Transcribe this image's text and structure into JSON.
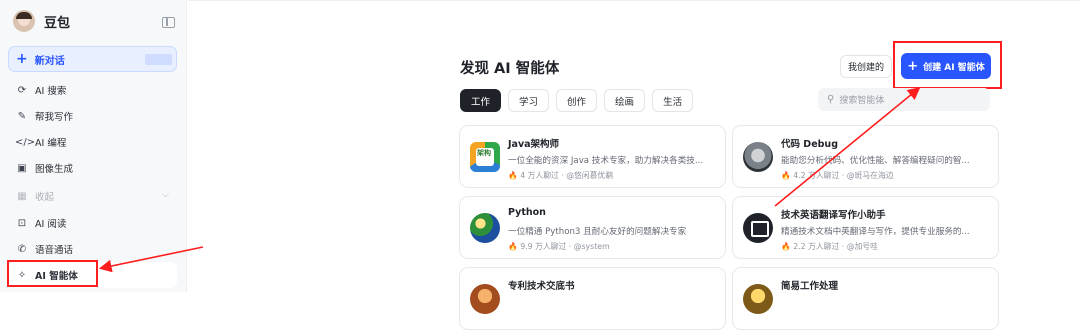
{
  "sidebar": {
    "brand_name": "豆包",
    "new_chat_label": "新对话",
    "items": [
      {
        "icon": "search-icon",
        "glyph": "⟳",
        "label": "AI 搜索"
      },
      {
        "icon": "pen-icon",
        "glyph": "✎",
        "label": "帮我写作"
      },
      {
        "icon": "code-icon",
        "glyph": "</>",
        "label": "AI 编程"
      },
      {
        "icon": "image-icon",
        "glyph": "▣",
        "label": "图像生成"
      },
      {
        "icon": "collapse-icon",
        "glyph": "▦",
        "label": "收起"
      },
      {
        "icon": "reader-icon",
        "glyph": "⊡",
        "label": "AI 阅读"
      },
      {
        "icon": "phone-icon",
        "glyph": "✆",
        "label": "语音通话"
      },
      {
        "icon": "sparkle-icon",
        "glyph": "✧",
        "label": "AI 智能体"
      }
    ]
  },
  "main": {
    "title": "发现 AI 智能体",
    "my_created_label": "我创建的",
    "create_label": "创建 AI 智能体",
    "search_placeholder": "搜索智能体",
    "tabs": [
      "工作",
      "学习",
      "创作",
      "绘画",
      "生活"
    ],
    "active_tab": "工作"
  },
  "agents": [
    {
      "title": "Java架构师",
      "desc": "一位全能的资深 Java 技术专家，助力解决各类技...",
      "meta": "4 万人聊过 · @悠闲慕优鹬",
      "icon": "java-architect-icon"
    },
    {
      "title": "代码 Debug",
      "desc": "能助您分析代码、优化性能、解答编程疑问的智...",
      "meta": "4.2 万人聊过 · @斑马在海边",
      "icon": "debug-icon"
    },
    {
      "title": "Python",
      "desc": "一位精通 Python3 且耐心友好的问题解决专家",
      "meta": "9.9 万人聊过 · @system",
      "icon": "python-icon"
    },
    {
      "title": "技术英语翻译写作小助手",
      "desc": "精通技术文档中英翻译与写作，提供专业服务的...",
      "meta": "2.2 万人聊过 · @加号哇",
      "icon": "translate-icon"
    },
    {
      "title": "专利技术交底书",
      "desc": "",
      "meta": "",
      "icon": "patent-icon"
    },
    {
      "title": "简易工作处理",
      "desc": "",
      "meta": "",
      "icon": "work-icon"
    }
  ],
  "java_icon_text": "架构",
  "colors": {
    "accent": "#2955ff",
    "highlight": "#ff1e1e"
  }
}
